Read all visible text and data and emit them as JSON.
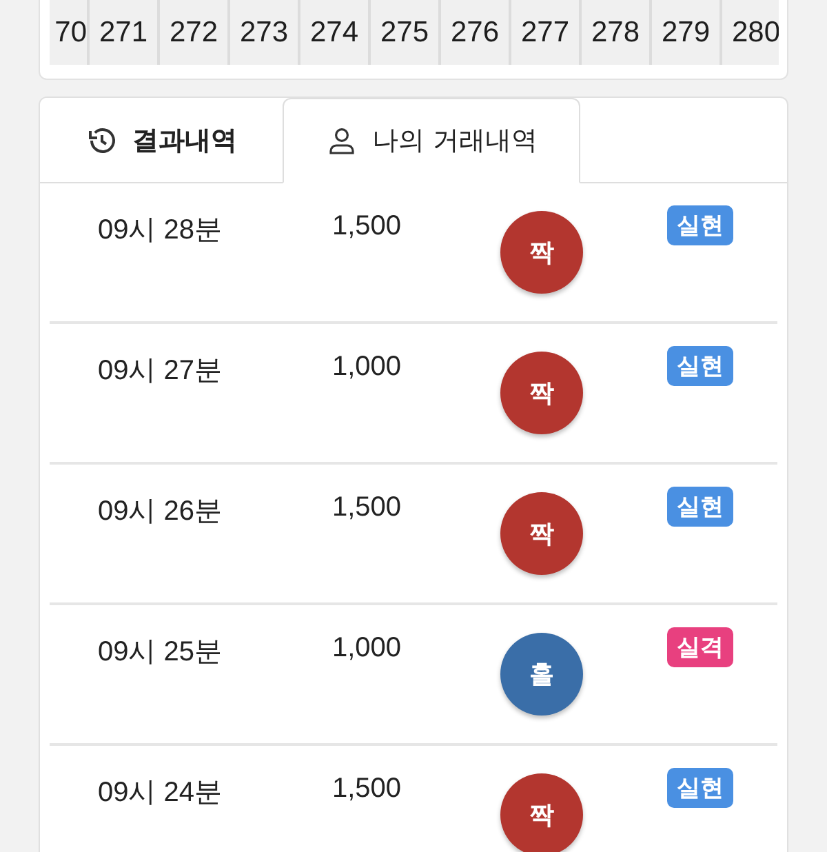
{
  "rounds": [
    "70",
    "271",
    "272",
    "273",
    "274",
    "275",
    "276",
    "277",
    "278",
    "279",
    "280"
  ],
  "tabs": [
    {
      "label": "결과내역",
      "selected": false
    },
    {
      "label": "나의 거래내역",
      "selected": true
    }
  ],
  "bets": [
    {
      "time": "09시 28분",
      "amount": "1,500",
      "pick": {
        "label": "짝",
        "color": "#b3362f"
      },
      "result": {
        "label": "실현",
        "color": "#4a90e2"
      }
    },
    {
      "time": "09시 27분",
      "amount": "1,000",
      "pick": {
        "label": "짝",
        "color": "#b3362f"
      },
      "result": {
        "label": "실현",
        "color": "#4a90e2"
      }
    },
    {
      "time": "09시 26분",
      "amount": "1,500",
      "pick": {
        "label": "짝",
        "color": "#b3362f"
      },
      "result": {
        "label": "실현",
        "color": "#4a90e2"
      }
    },
    {
      "time": "09시 25분",
      "amount": "1,000",
      "pick": {
        "label": "홀",
        "color": "#3a6ea8"
      },
      "result": {
        "label": "실격",
        "color": "#e8407f"
      }
    },
    {
      "time": "09시 24분",
      "amount": "1,500",
      "pick": {
        "label": "짝",
        "color": "#b3362f"
      },
      "result": {
        "label": "실현",
        "color": "#4a90e2"
      }
    }
  ]
}
